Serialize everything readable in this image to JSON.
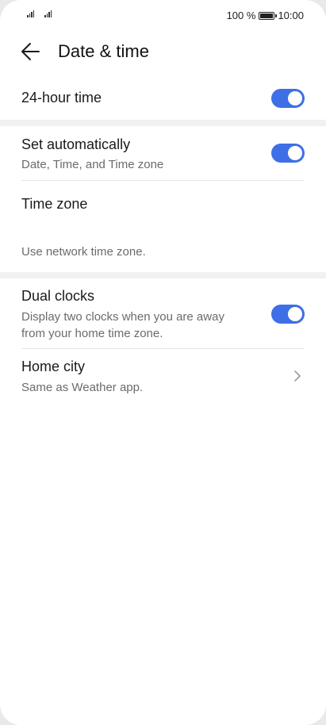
{
  "status_bar": {
    "battery_percent": "100 %",
    "battery_level": 1.0,
    "time": "10:00"
  },
  "header": {
    "title": "Date & time",
    "back_icon": "arrow-left-icon"
  },
  "settings": {
    "hour24": {
      "label": "24-hour time",
      "enabled": true
    },
    "set_automatically": {
      "label": "Set automatically",
      "description": "Date, Time, and Time zone",
      "enabled": true
    },
    "time_zone": {
      "label": "Time zone",
      "description": "Use network time zone."
    },
    "dual_clocks": {
      "label": "Dual clocks",
      "description_line1": "Display two clocks when you are away",
      "description_line2": "from your home time zone.",
      "enabled": true
    },
    "home_city": {
      "label": "Home city",
      "description": "Same as Weather app.",
      "chevron_icon": "chevron-right-icon"
    }
  },
  "colors": {
    "toggle_on": "#3e6fe6",
    "background": "#ffffff",
    "section_gap": "#f1f1f1"
  }
}
